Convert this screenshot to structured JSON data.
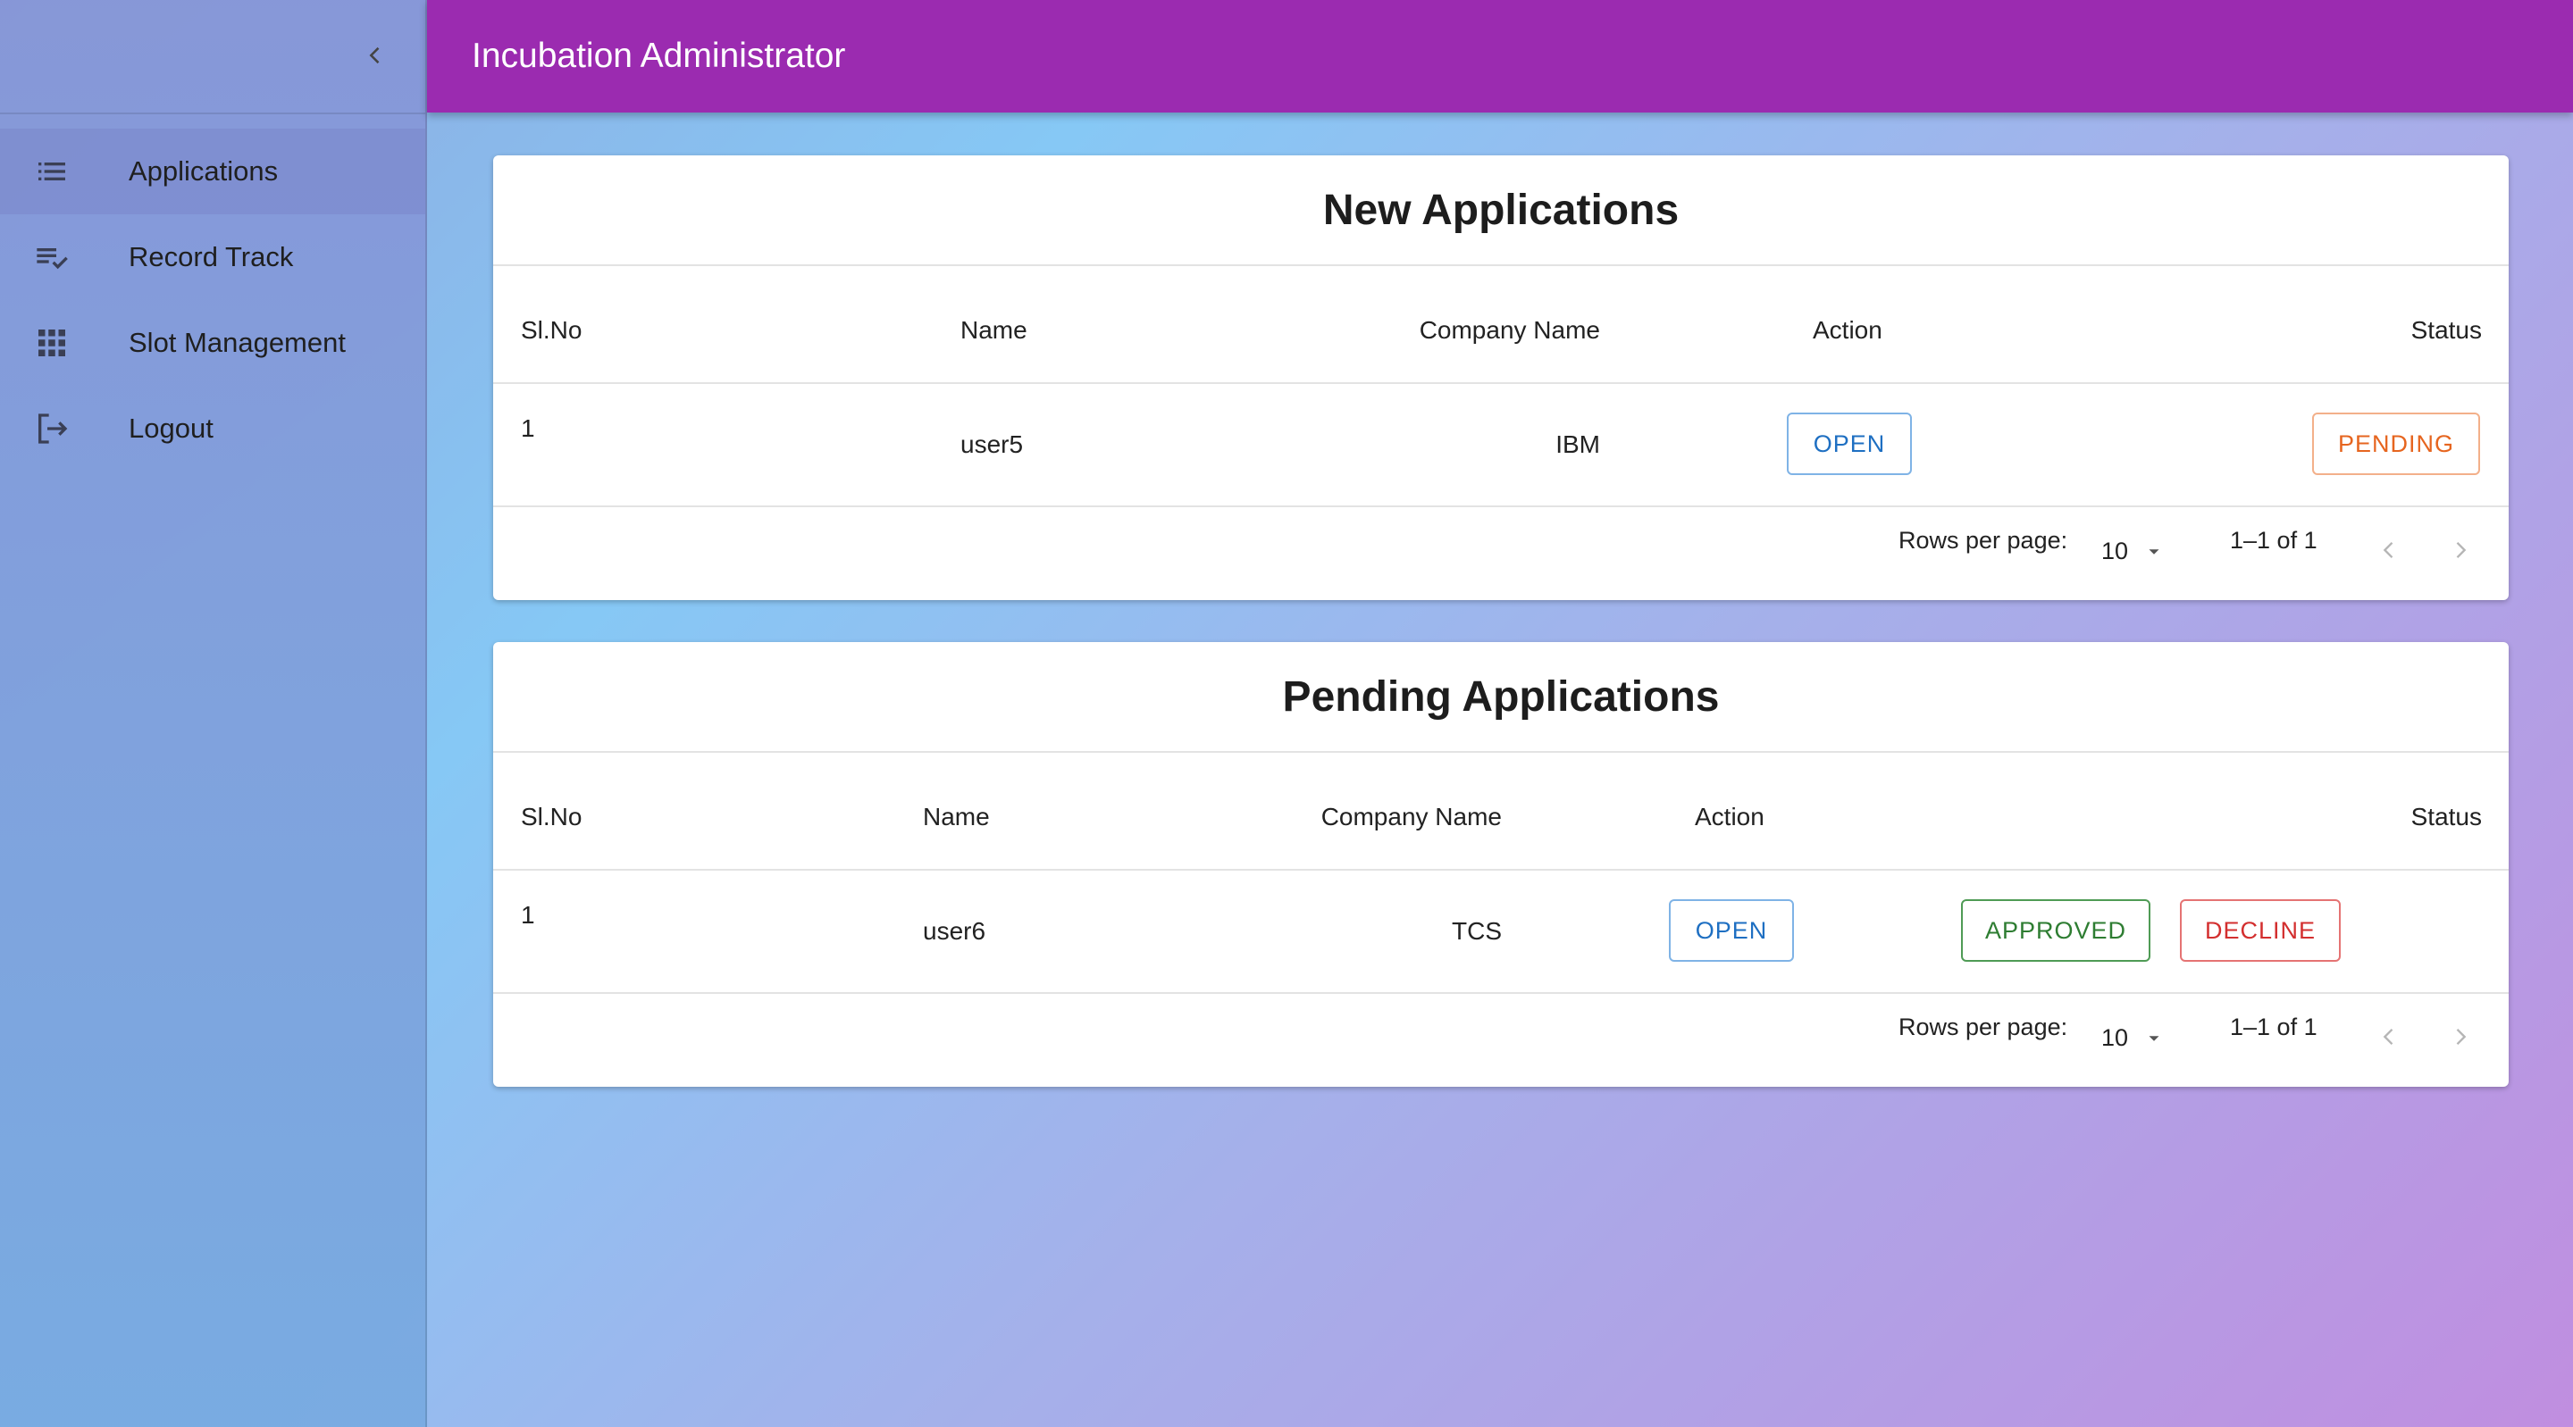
{
  "header": {
    "title": "Incubation Administrator"
  },
  "sidebar": {
    "items": [
      {
        "label": "Applications",
        "icon": "list-icon",
        "active": true
      },
      {
        "label": "Record Track",
        "icon": "playlist-check-icon"
      },
      {
        "label": "Slot Management",
        "icon": "grid-icon"
      },
      {
        "label": "Logout",
        "icon": "logout-icon"
      }
    ]
  },
  "new_applications": {
    "title": "New Applications",
    "columns": [
      "Sl.No",
      "Name",
      "Company Name",
      "Action",
      "Status"
    ],
    "rows": [
      {
        "slno": "1",
        "name": "user5",
        "company": "IBM",
        "action": "OPEN",
        "status": "PENDING"
      }
    ],
    "footer": {
      "rows_per_page_label": "Rows per page:",
      "rows_per_page": "10",
      "range": "1–1 of 1"
    }
  },
  "pending_applications": {
    "title": "Pending Applications",
    "columns": [
      "Sl.No",
      "Name",
      "Company Name",
      "Action",
      "Status"
    ],
    "rows": [
      {
        "slno": "1",
        "name": "user6",
        "company": "TCS",
        "action": "OPEN",
        "approve": "APPROVED",
        "decline": "DECLINE"
      }
    ],
    "footer": {
      "rows_per_page_label": "Rows per page:",
      "rows_per_page": "10",
      "range": "1–1 of 1"
    }
  },
  "colors": {
    "appbar": "#9b2bb0",
    "open": "#1e6fc2",
    "pending": "#e6651f",
    "approved": "#2e7d32",
    "decline": "#d32f2f"
  }
}
